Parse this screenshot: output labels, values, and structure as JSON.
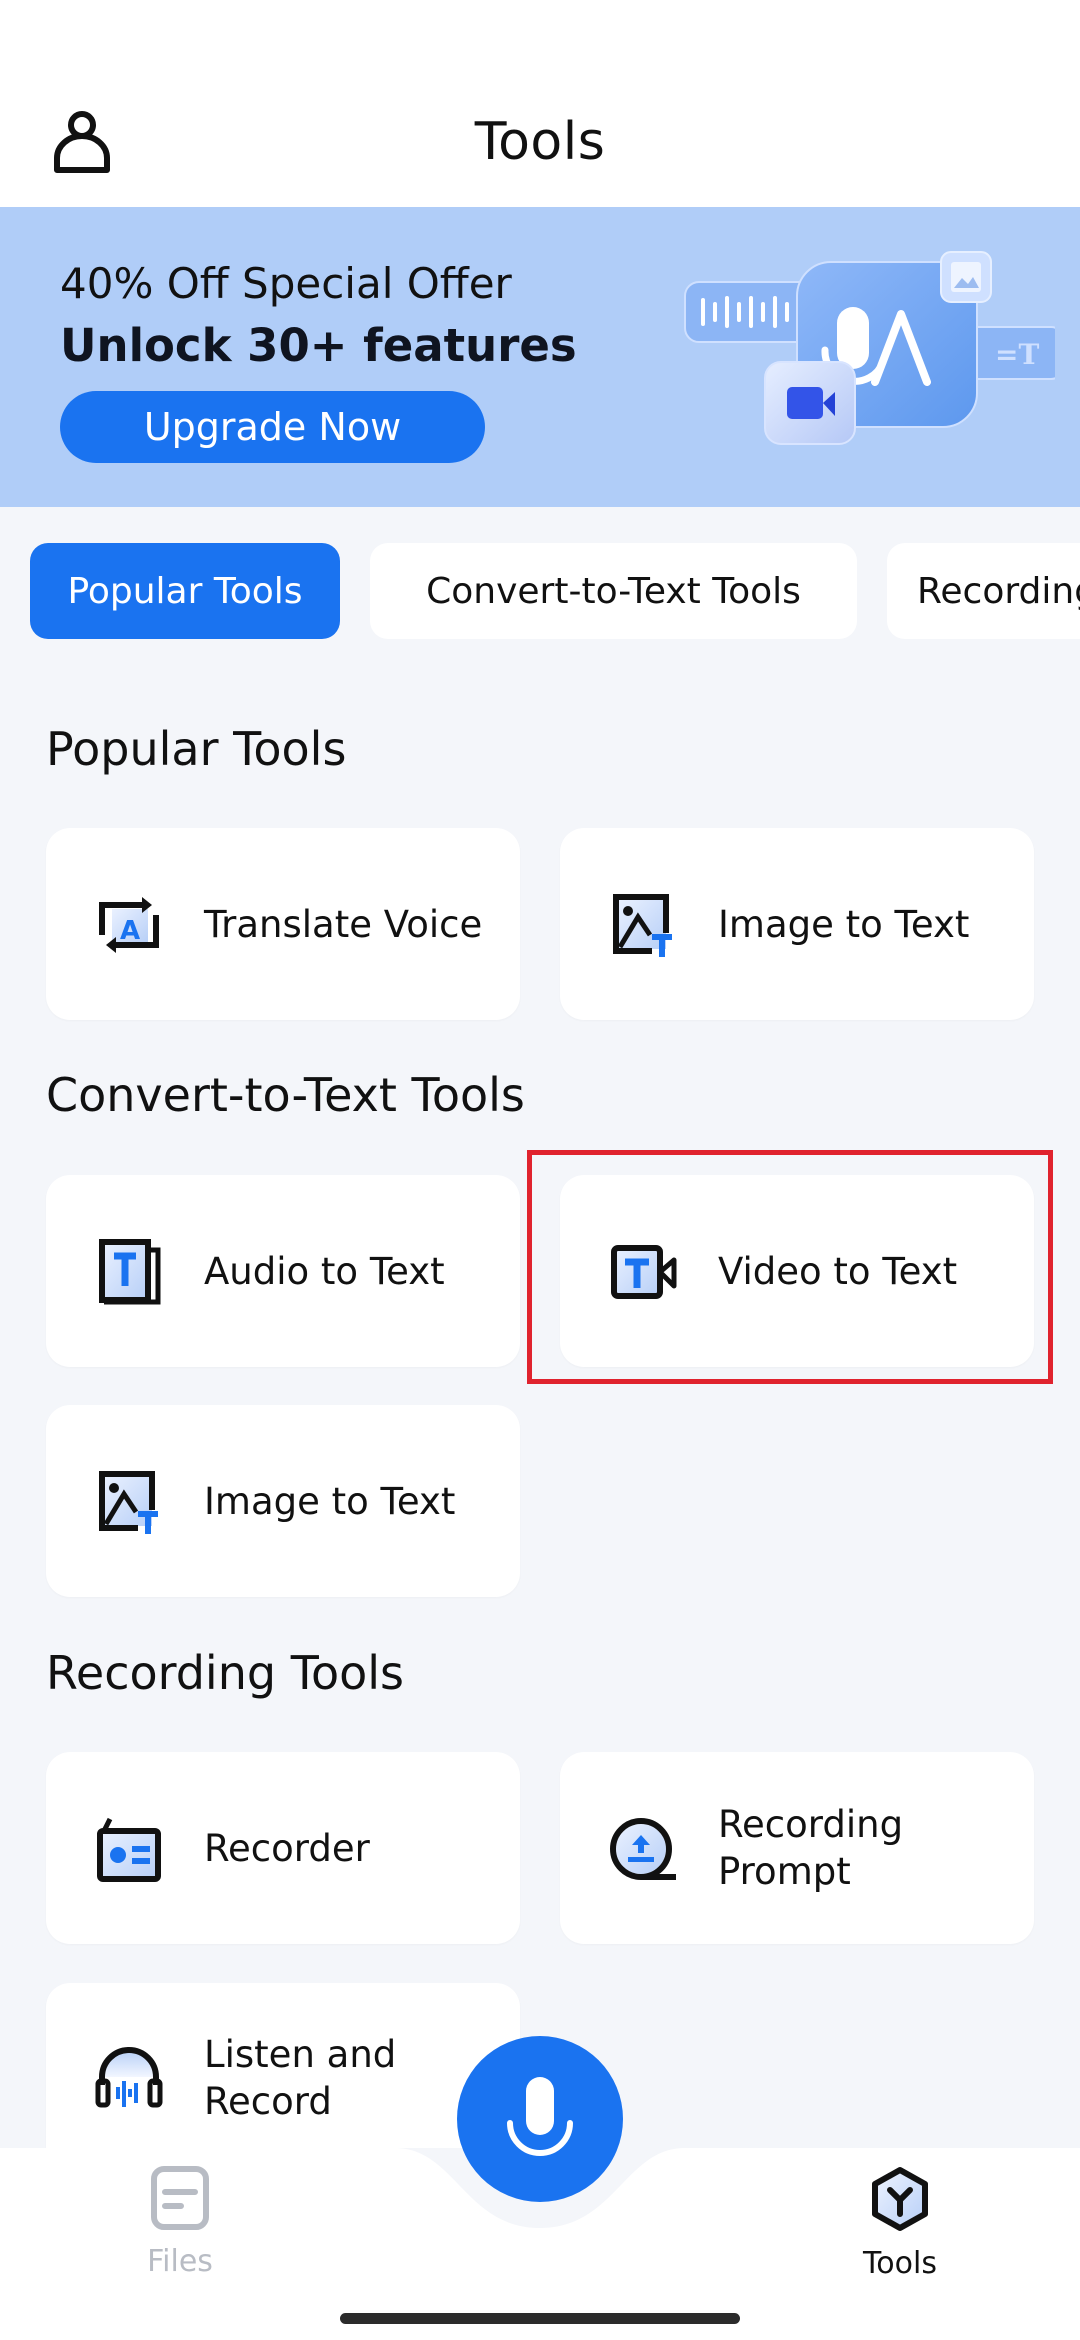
{
  "header": {
    "title": "Tools",
    "profile_icon": "person-icon"
  },
  "banner": {
    "line1": "40% Off Special Offer",
    "line2": "Unlock 30+ features",
    "button_label": "Upgrade Now",
    "illustration": "voice-to-text-illustration"
  },
  "chips": [
    {
      "label": "Popular Tools",
      "active": true
    },
    {
      "label": "Convert-to-Text Tools",
      "active": false
    },
    {
      "label": "Recording Tools",
      "active": false
    }
  ],
  "sections": [
    {
      "title": "Popular Tools",
      "items": [
        {
          "label": "Translate Voice",
          "icon": "translate-icon"
        },
        {
          "label": "Image to Text",
          "icon": "image-text-icon"
        }
      ]
    },
    {
      "title": "Convert-to-Text Tools",
      "items": [
        {
          "label": "Audio to Text",
          "icon": "audio-text-icon"
        },
        {
          "label": "Video to Text",
          "icon": "video-text-icon",
          "highlighted": true
        },
        {
          "label": "Image to Text",
          "icon": "image-text-icon"
        }
      ]
    },
    {
      "title": "Recording Tools",
      "items": [
        {
          "label": "Recorder",
          "icon": "recorder-icon"
        },
        {
          "label": "Recording Prompt",
          "icon": "teleprompter-icon"
        },
        {
          "label": "Listen and Record",
          "icon": "headphones-icon"
        }
      ]
    }
  ],
  "nav": {
    "items": [
      {
        "label": "Files",
        "icon": "files-icon",
        "active": false
      },
      {
        "label": "Tools",
        "icon": "tools-icon",
        "active": true
      }
    ],
    "fab_icon": "microphone-icon"
  },
  "colors": {
    "accent": "#1a73f0",
    "banner_bg": "#b0cdf8",
    "page_bg": "#f4f6fa",
    "highlight": "#e0232e",
    "inactive_nav": "#b8bcc4"
  }
}
